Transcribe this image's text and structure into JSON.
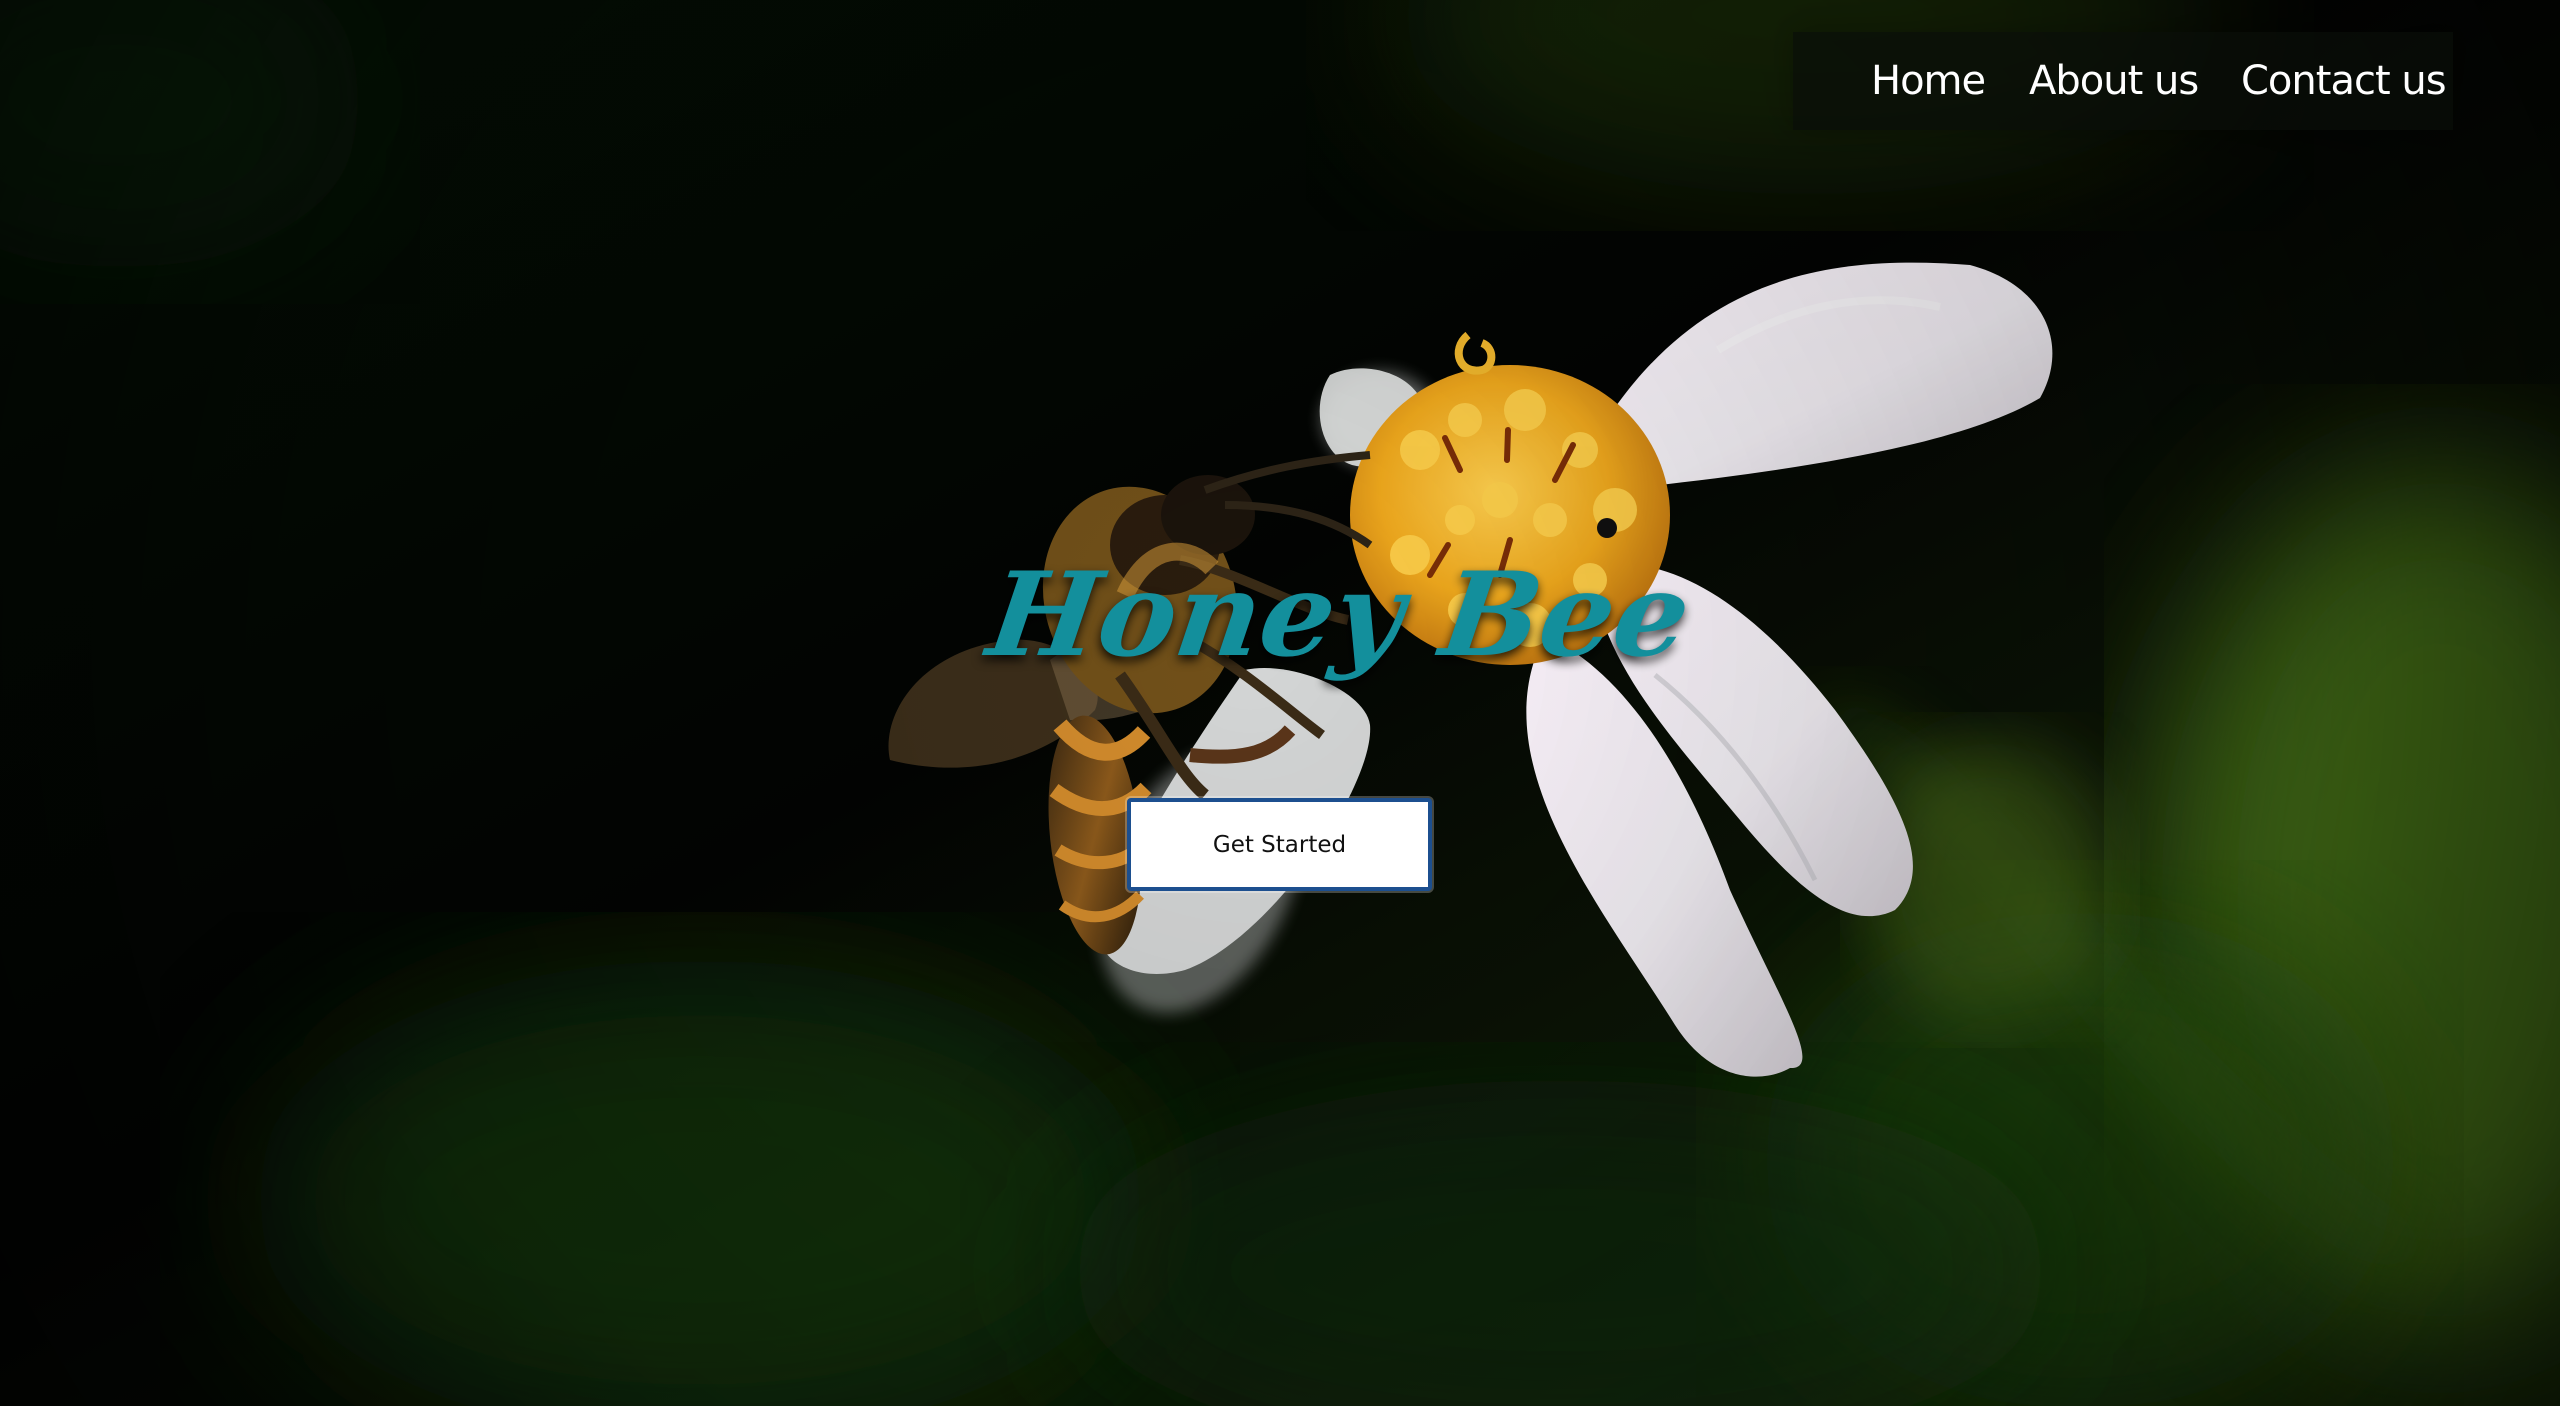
{
  "nav": {
    "items": [
      {
        "label": "Home"
      },
      {
        "label": "About us"
      },
      {
        "label": "Contact us"
      }
    ]
  },
  "hero": {
    "title": "Honey Bee",
    "cta_label": "Get Started",
    "image": {
      "subject": "bee-on-white-daisy",
      "background_color": "#050805",
      "accent_color": "#138f9c",
      "flower_color": "#f3b52f"
    }
  }
}
